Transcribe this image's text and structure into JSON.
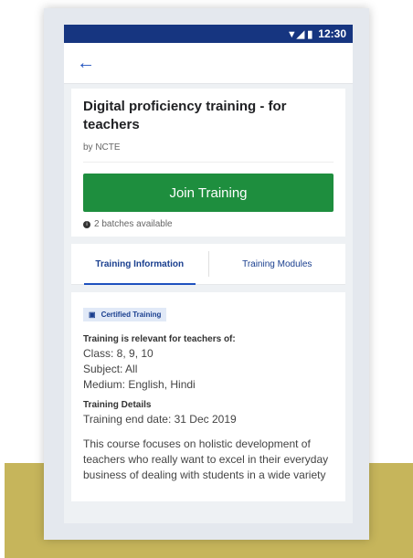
{
  "status_bar": {
    "icons": "▼◢ ▮",
    "time": "12:30"
  },
  "app_bar": {
    "back_icon": "←"
  },
  "course": {
    "title": "Digital proficiency training - for teachers",
    "byline": "by NCTE",
    "join_label": "Join Training",
    "batches_text": "2 batches available",
    "info_icon": "i"
  },
  "tabs": [
    {
      "label": "Training Information"
    },
    {
      "label": "Training Modules"
    }
  ],
  "details": {
    "badge_icon": "▣",
    "badge_text": "Certified Training",
    "relevant_label": "Training is relevant for teachers of:",
    "class_line": "Class: 8, 9, 10",
    "subject_line": "Subject: All",
    "medium_line": "Medium: English, Hindi",
    "details_label": "Training Details",
    "end_date_line": "Training end date: 31 Dec 2019",
    "description": "This course focuses on holistic development of teachers who really want to excel in their everyday business of dealing with students in a wide variety"
  },
  "colors": {
    "status_bar": "#163580",
    "primary": "#1f51bf",
    "join": "#1e8e3e",
    "gold_block": "#c6b55b"
  }
}
